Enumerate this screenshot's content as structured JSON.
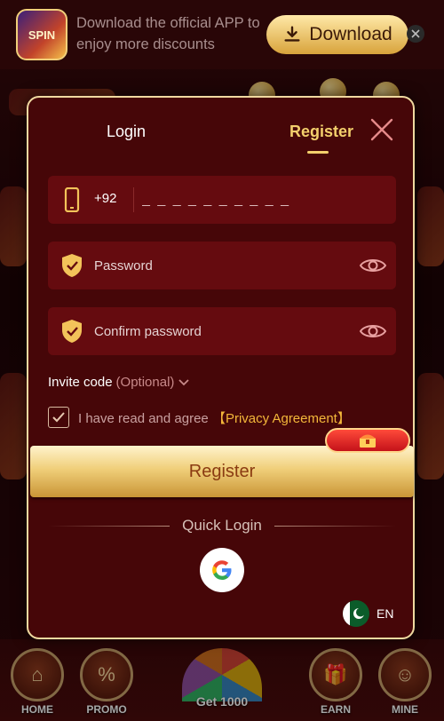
{
  "banner": {
    "app_logo_text": "SPIN",
    "text": "Download the official APP to enjoy more discounts",
    "download_label": "Download"
  },
  "modal": {
    "tabs": {
      "login": "Login",
      "register": "Register"
    },
    "phone": {
      "prefix": "+92",
      "placeholder": "_ _ _ _ _ _ _ _ _ _"
    },
    "password": {
      "placeholder": "Password"
    },
    "confirm_password": {
      "placeholder": "Confirm password"
    },
    "invite": {
      "label": "Invite code",
      "optional": "(Optional)"
    },
    "agreement": {
      "text": "I have read and agree",
      "link": "【Privacy Agreement】",
      "checked": true
    },
    "register_button": "Register",
    "quick_login": "Quick Login",
    "language": "EN"
  },
  "bottom_nav": {
    "items": [
      {
        "label": "HOME"
      },
      {
        "label": "PROMO"
      },
      {
        "label": "EARN"
      },
      {
        "label": "MINE"
      }
    ],
    "center_label": "Get 1000"
  },
  "colors": {
    "accent": "#f3cf6c",
    "modal_bg": "#460608",
    "field_bg": "#650b0f",
    "link": "#f3b73a"
  }
}
